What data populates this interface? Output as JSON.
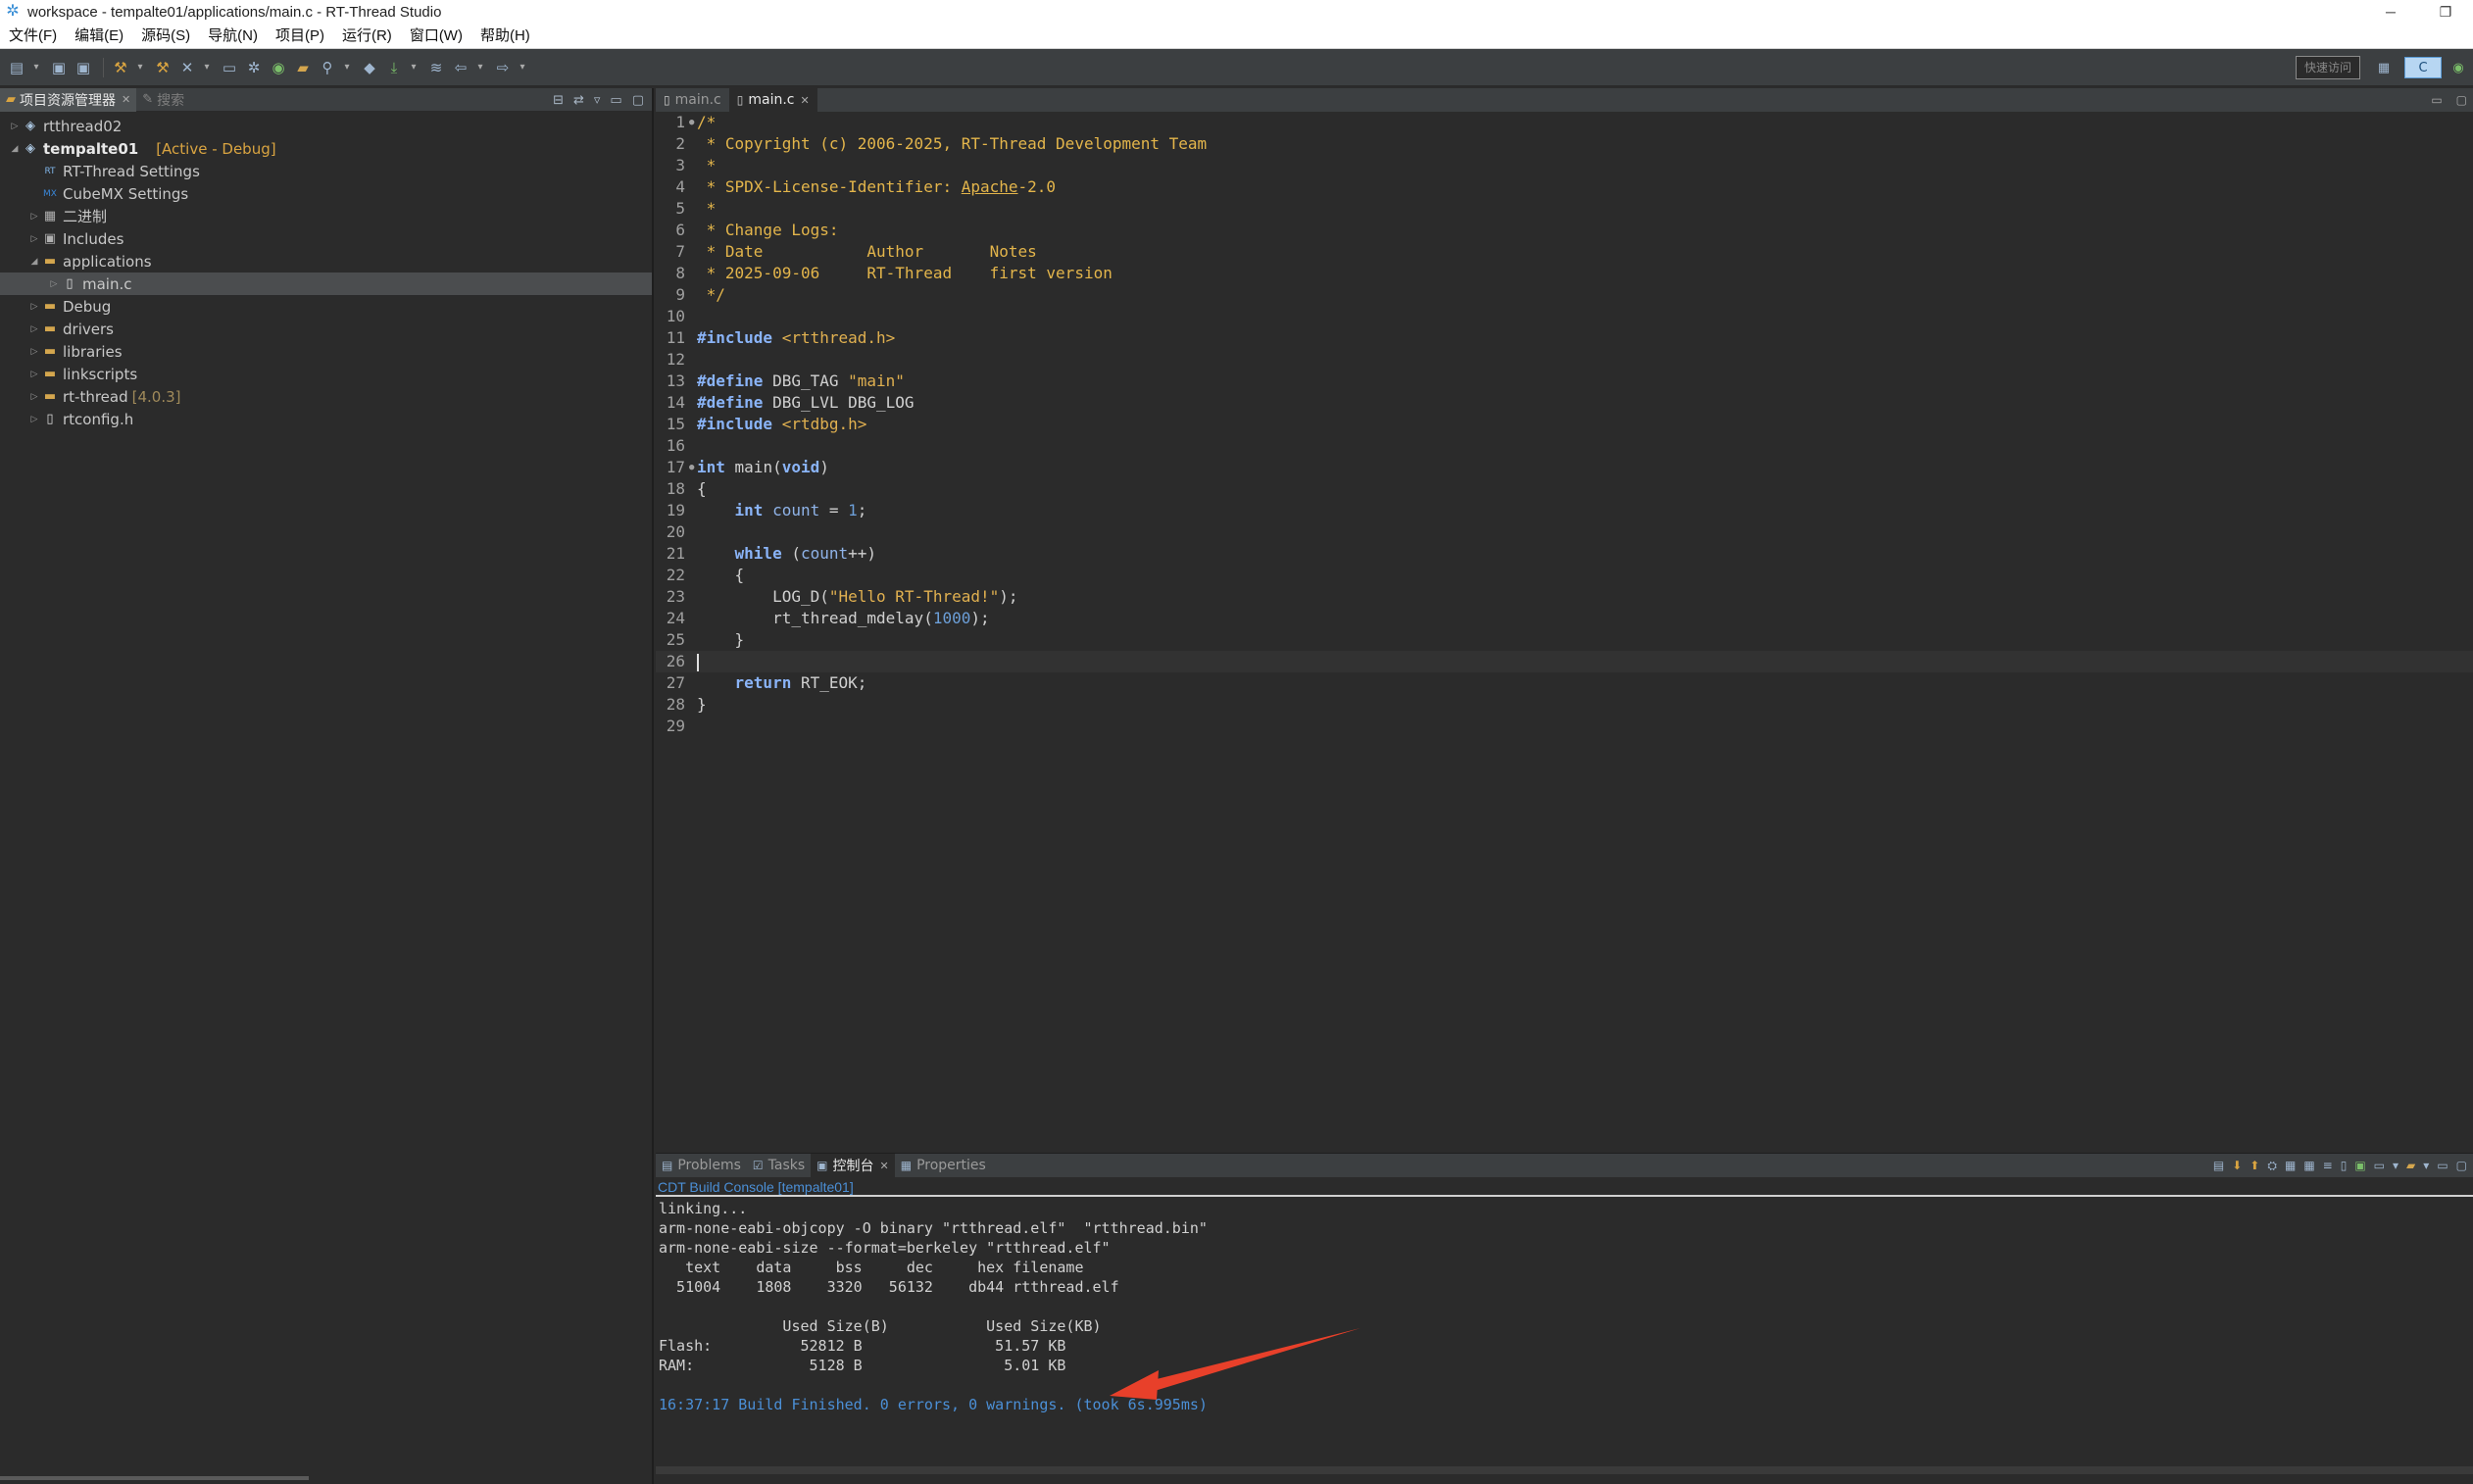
{
  "window": {
    "title": "workspace - tempalte01/applications/main.c - RT-Thread Studio",
    "minimize": "─",
    "restore": "❐"
  },
  "menu": [
    "文件(F)",
    "编辑(E)",
    "源码(S)",
    "导航(N)",
    "项目(P)",
    "运行(R)",
    "窗口(W)",
    "帮助(H)"
  ],
  "toolbar": {
    "quick_access_placeholder": "快速访问"
  },
  "project_explorer": {
    "tab_label": "项目资源管理器",
    "search_tab_label": "搜索",
    "tree": [
      {
        "level": 0,
        "twisty": "▷",
        "icon": "project-icon",
        "glyph": "◈",
        "label": "rtthread02",
        "bold": false
      },
      {
        "level": 0,
        "twisty": "◢",
        "icon": "project-icon",
        "glyph": "◈",
        "label": "tempalte01",
        "bold": true,
        "decoration": "[Active - Debug]"
      },
      {
        "level": 1,
        "twisty": "",
        "icon": "rt-settings-icon",
        "glyph": "RT",
        "label": "RT-Thread Settings"
      },
      {
        "level": 1,
        "twisty": "",
        "icon": "cubemx-icon",
        "glyph": "MX",
        "label": "CubeMX Settings"
      },
      {
        "level": 1,
        "twisty": "▷",
        "icon": "binaries-icon",
        "glyph": "▦",
        "label": "二进制"
      },
      {
        "level": 1,
        "twisty": "▷",
        "icon": "includes-icon",
        "glyph": "▣",
        "label": "Includes"
      },
      {
        "level": 1,
        "twisty": "◢",
        "icon": "folder-icon",
        "glyph": "▬",
        "label": "applications"
      },
      {
        "level": 2,
        "twisty": "▷",
        "icon": "c-file-icon",
        "glyph": "▯",
        "label": "main.c",
        "selected": true
      },
      {
        "level": 1,
        "twisty": "▷",
        "icon": "folder-icon",
        "glyph": "▬",
        "label": "Debug"
      },
      {
        "level": 1,
        "twisty": "▷",
        "icon": "folder-icon",
        "glyph": "▬",
        "label": "drivers"
      },
      {
        "level": 1,
        "twisty": "▷",
        "icon": "folder-icon",
        "glyph": "▬",
        "label": "libraries"
      },
      {
        "level": 1,
        "twisty": "▷",
        "icon": "folder-icon",
        "glyph": "▬",
        "label": "linkscripts"
      },
      {
        "level": 1,
        "twisty": "▷",
        "icon": "folder-icon",
        "glyph": "▬",
        "label": "rt-thread",
        "version": "[4.0.3]"
      },
      {
        "level": 1,
        "twisty": "▷",
        "icon": "h-file-icon",
        "glyph": "▯",
        "label": "rtconfig.h"
      }
    ]
  },
  "editor": {
    "tabs": [
      {
        "label": "main.c",
        "active": false
      },
      {
        "label": "main.c",
        "active": true
      }
    ],
    "current_line": 26,
    "lines": [
      {
        "n": "1",
        "mark": "●",
        "t": [
          [
            "cm",
            "/*"
          ]
        ]
      },
      {
        "n": "2",
        "t": [
          [
            "cm",
            " * Copyright (c) 2006-2025, RT-Thread Development Team"
          ]
        ]
      },
      {
        "n": "3",
        "t": [
          [
            "cm",
            " *"
          ]
        ]
      },
      {
        "n": "4",
        "t": [
          [
            "cm",
            " * SPDX-License-Identifier: "
          ],
          [
            "cmu",
            "Apache"
          ],
          [
            "cm",
            "-2.0"
          ]
        ]
      },
      {
        "n": "5",
        "t": [
          [
            "cm",
            " *"
          ]
        ]
      },
      {
        "n": "6",
        "t": [
          [
            "cm",
            " * Change Logs:"
          ]
        ]
      },
      {
        "n": "7",
        "t": [
          [
            "cm",
            " * Date           Author       Notes"
          ]
        ]
      },
      {
        "n": "8",
        "t": [
          [
            "cm",
            " * 2025-09-06     RT-Thread    first version"
          ]
        ]
      },
      {
        "n": "9",
        "t": [
          [
            "cm",
            " */"
          ]
        ]
      },
      {
        "n": "10",
        "t": []
      },
      {
        "n": "11",
        "t": [
          [
            "pp",
            "#include"
          ],
          [
            "src",
            " "
          ],
          [
            "inc",
            "<rtthread.h>"
          ]
        ]
      },
      {
        "n": "12",
        "t": []
      },
      {
        "n": "13",
        "t": [
          [
            "pp",
            "#define"
          ],
          [
            "src",
            " DBG_TAG "
          ],
          [
            "str",
            "\"main\""
          ]
        ]
      },
      {
        "n": "14",
        "t": [
          [
            "pp",
            "#define"
          ],
          [
            "src",
            " DBG_LVL DBG_LOG"
          ]
        ]
      },
      {
        "n": "15",
        "t": [
          [
            "pp",
            "#include"
          ],
          [
            "src",
            " "
          ],
          [
            "inc",
            "<rtdbg.h>"
          ]
        ]
      },
      {
        "n": "16",
        "t": []
      },
      {
        "n": "17",
        "mark": "●",
        "t": [
          [
            "kw",
            "int"
          ],
          [
            "src",
            " main("
          ],
          [
            "kw",
            "void"
          ],
          [
            "src",
            ")"
          ]
        ]
      },
      {
        "n": "18",
        "t": [
          [
            "src",
            "{"
          ]
        ]
      },
      {
        "n": "19",
        "t": [
          [
            "src",
            "    "
          ],
          [
            "kw",
            "int"
          ],
          [
            "src",
            " "
          ],
          [
            "var",
            "count"
          ],
          [
            "src",
            " = "
          ],
          [
            "num",
            "1"
          ],
          [
            "src",
            ";"
          ]
        ]
      },
      {
        "n": "20",
        "t": []
      },
      {
        "n": "21",
        "t": [
          [
            "src",
            "    "
          ],
          [
            "kw",
            "while"
          ],
          [
            "src",
            " ("
          ],
          [
            "var",
            "count"
          ],
          [
            "src",
            "++)"
          ]
        ]
      },
      {
        "n": "22",
        "t": [
          [
            "src",
            "    {"
          ]
        ]
      },
      {
        "n": "23",
        "t": [
          [
            "src",
            "        LOG_D("
          ],
          [
            "str",
            "\"Hello RT-Thread!\""
          ],
          [
            "src",
            ");"
          ]
        ]
      },
      {
        "n": "24",
        "t": [
          [
            "src",
            "        rt_thread_mdelay("
          ],
          [
            "num",
            "1000"
          ],
          [
            "src",
            ");"
          ]
        ]
      },
      {
        "n": "25",
        "t": [
          [
            "src",
            "    }"
          ]
        ]
      },
      {
        "n": "26",
        "t": []
      },
      {
        "n": "27",
        "t": [
          [
            "src",
            "    "
          ],
          [
            "kw",
            "return"
          ],
          [
            "src",
            " RT_EOK;"
          ]
        ]
      },
      {
        "n": "28",
        "t": [
          [
            "src",
            "}"
          ]
        ]
      },
      {
        "n": "29",
        "t": []
      }
    ]
  },
  "console": {
    "tabs": [
      {
        "label": "Problems",
        "icon": "problems-icon",
        "active": false
      },
      {
        "label": "Tasks",
        "icon": "tasks-icon",
        "active": false
      },
      {
        "label": "控制台",
        "icon": "console-icon",
        "active": true
      },
      {
        "label": "Properties",
        "icon": "properties-icon",
        "active": false
      }
    ],
    "console_name": "CDT Build Console [tempalte01]",
    "lines": [
      "linking...",
      "arm-none-eabi-objcopy -O binary \"rtthread.elf\"  \"rtthread.bin\"",
      "arm-none-eabi-size --format=berkeley \"rtthread.elf\"",
      "   text    data     bss     dec     hex filename",
      "  51004    1808    3320   56132    db44 rtthread.elf",
      "",
      "              Used Size(B)           Used Size(KB)",
      "Flash:          52812 B               51.57 KB",
      "RAM:             5128 B                5.01 KB",
      ""
    ],
    "finish_line": "16:37:17 Build Finished. 0 errors, 0 warnings. (took 6s.995ms)"
  },
  "colors": {
    "background": "#2b2b2b",
    "comment": "#e3b54b",
    "keyword": "#8ab4f8",
    "console_blue": "#4b8fd6",
    "annotation_arrow": "#e8402a"
  }
}
